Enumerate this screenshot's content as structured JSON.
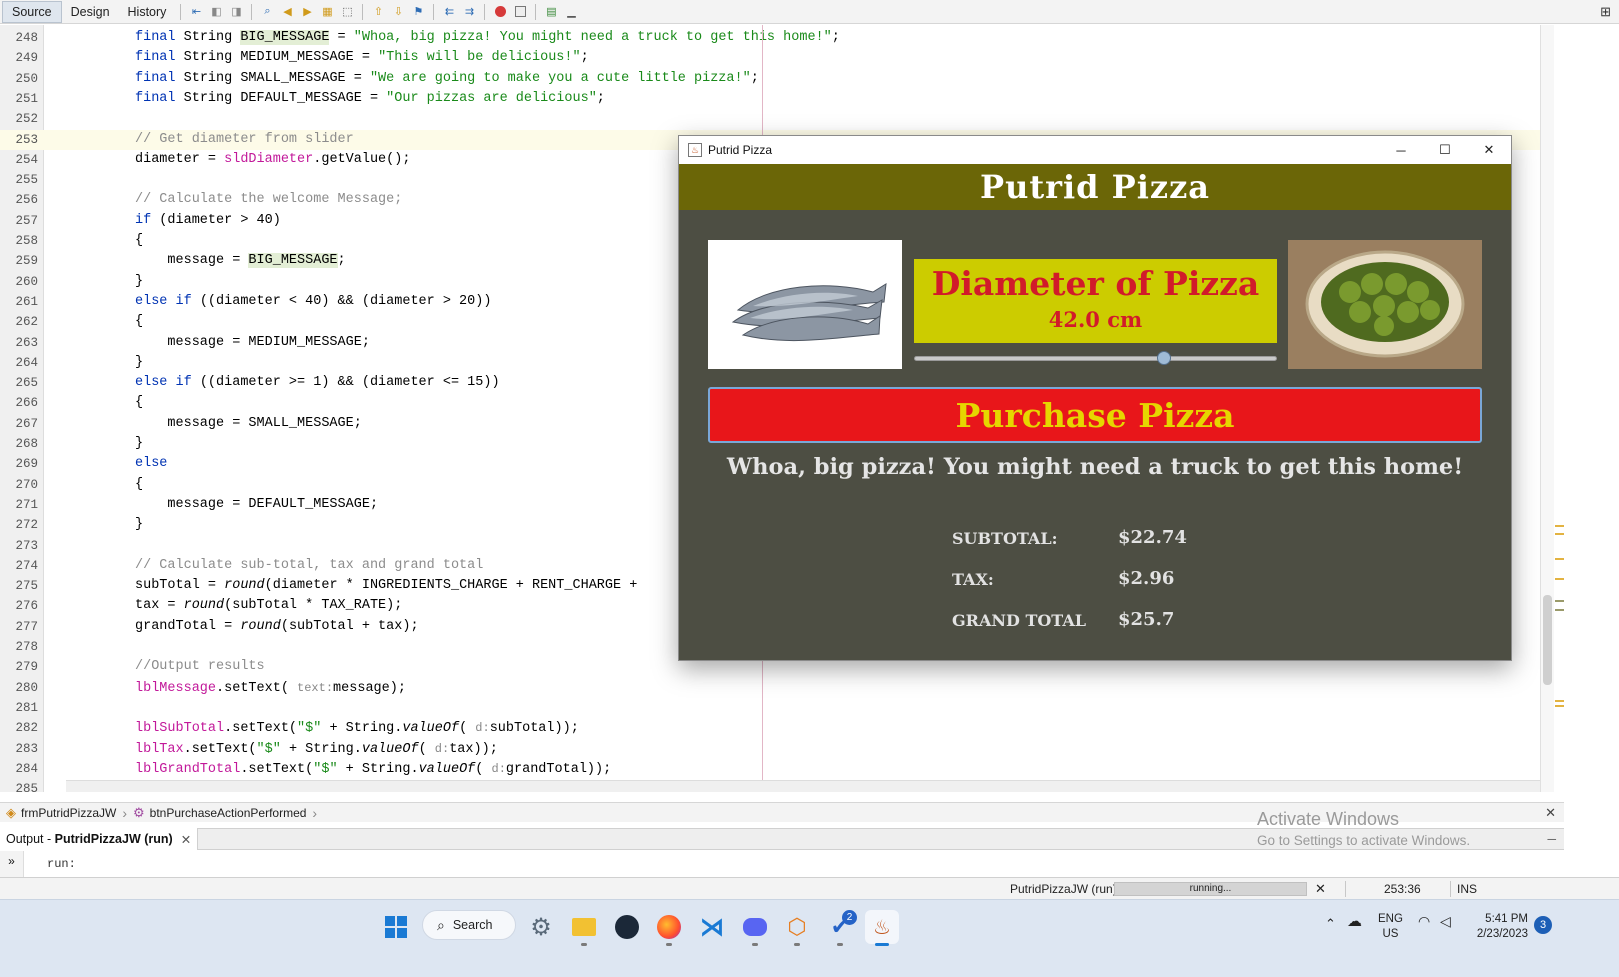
{
  "ide": {
    "tabs": [
      "Source",
      "Design",
      "History"
    ],
    "code_lines": [
      {
        "n": "248",
        "html": "<span class=\"kw\">final</span> String <span class=\"hl\">BIG_MESSAGE</span> = <span class=\"str\">\"Whoa, big pizza! You might need a truck to get this home!\"</span>;"
      },
      {
        "n": "249",
        "html": "<span class=\"kw\">final</span> String MEDIUM_MESSAGE = <span class=\"str\">\"This will be delicious!\"</span>;"
      },
      {
        "n": "250",
        "html": "<span class=\"kw\">final</span> String SMALL_MESSAGE = <span class=\"str\">\"We are going to make you a cute little pizza!\"</span>;"
      },
      {
        "n": "251",
        "html": "<span class=\"kw\">final</span> String DEFAULT_MESSAGE = <span class=\"str\">\"Our pizzas are delicious\"</span>;"
      },
      {
        "n": "252",
        "html": ""
      },
      {
        "n": "253",
        "html": "<span class=\"cmt\">// Get diameter from slider</span>",
        "current": true
      },
      {
        "n": "254",
        "html": "diameter = <span class=\"fld\">sldDiameter</span>.getValue();"
      },
      {
        "n": "255",
        "html": ""
      },
      {
        "n": "256",
        "html": "<span class=\"cmt\">// Calculate the welcome Message;</span>"
      },
      {
        "n": "257",
        "html": "<span class=\"kw\">if</span> (diameter &gt; 40)"
      },
      {
        "n": "258",
        "html": "{"
      },
      {
        "n": "259",
        "html": "    message = <span class=\"hl\">BIG_MESSAGE</span>;"
      },
      {
        "n": "260",
        "html": "}"
      },
      {
        "n": "261",
        "html": "<span class=\"kw\">else if</span> ((diameter &lt; 40) &amp;&amp; (diameter &gt; 20))"
      },
      {
        "n": "262",
        "html": "{"
      },
      {
        "n": "263",
        "html": "    message = MEDIUM_MESSAGE;"
      },
      {
        "n": "264",
        "html": "}"
      },
      {
        "n": "265",
        "html": "<span class=\"kw\">else if</span> ((diameter &gt;= 1) &amp;&amp; (diameter &lt;= 15))"
      },
      {
        "n": "266",
        "html": "{"
      },
      {
        "n": "267",
        "html": "    message = SMALL_MESSAGE;"
      },
      {
        "n": "268",
        "html": "}"
      },
      {
        "n": "269",
        "html": "<span class=\"kw\">else</span>"
      },
      {
        "n": "270",
        "html": "{"
      },
      {
        "n": "271",
        "html": "    message = DEFAULT_MESSAGE;"
      },
      {
        "n": "272",
        "html": "}"
      },
      {
        "n": "273",
        "html": ""
      },
      {
        "n": "274",
        "html": "<span class=\"cmt\">// Calculate sub-total, tax and grand total</span>"
      },
      {
        "n": "275",
        "html": "subTotal = <span class=\"ital\">round</span>(diameter * INGREDIENTS_CHARGE + RENT_CHARGE +"
      },
      {
        "n": "276",
        "html": "tax = <span class=\"ital\">round</span>(subTotal * TAX_RATE);"
      },
      {
        "n": "277",
        "html": "grandTotal = <span class=\"ital\">round</span>(subTotal + tax);"
      },
      {
        "n": "278",
        "html": ""
      },
      {
        "n": "279",
        "html": "<span class=\"cmt\">//Output results</span>"
      },
      {
        "n": "280",
        "html": "<span class=\"fld\">lblMessage</span>.setText( <span class=\"hint\">text:</span>message);"
      },
      {
        "n": "281",
        "html": ""
      },
      {
        "n": "282",
        "html": "<span class=\"fld\">lblSubTotal</span>.setText(<span class=\"str\">\"$\"</span> + String.<span class=\"ital\">valueOf</span>( <span class=\"hint\">d:</span>subTotal));"
      },
      {
        "n": "283",
        "html": "<span class=\"fld\">lblTax</span>.setText(<span class=\"str\">\"$\"</span> + String.<span class=\"ital\">valueOf</span>( <span class=\"hint\">d:</span>tax));"
      },
      {
        "n": "284",
        "html": "<span class=\"fld\">lblGrandTotal</span>.setText(<span class=\"str\">\"$\"</span> + String.<span class=\"ital\">valueOf</span>( <span class=\"hint\">d:</span>grandTotal));"
      },
      {
        "n": "285",
        "html": "    }",
        "cut": true
      }
    ],
    "breadcrumb": {
      "form": "frmPutridPizzaJW",
      "method": "btnPurchaseActionPerformed"
    },
    "output": {
      "tab_prefix": "Output - ",
      "tab_project": "PutridPizzaJW (run)",
      "run_text": "run:"
    },
    "watermark": {
      "line1": "Activate Windows",
      "line2": "Go to Settings to activate Windows."
    },
    "status": {
      "project": "PutridPizzaJW (run)",
      "progress_text": "running...",
      "position": "253:36",
      "mode": "INS"
    }
  },
  "app": {
    "window_title": "Putrid Pizza",
    "header": "Putrid Pizza",
    "diameter_label": "Diameter of Pizza",
    "diameter_value": "42.0 cm",
    "slider": {
      "value_fraction": 0.69
    },
    "purchase_label": "Purchase Pizza",
    "message": "Whoa, big pizza! You might need a truck to get this home!",
    "totals": {
      "subtotal_label": "SUBTOTAL:",
      "subtotal_value": "$22.74",
      "tax_label": "TAX:",
      "tax_value": "$2.96",
      "grand_label": "GRAND TOTAL",
      "grand_value": "$25.7"
    }
  },
  "taskbar": {
    "search_label": "Search",
    "lang": "ENG",
    "region": "US",
    "time": "5:41 PM",
    "date": "2/23/2023",
    "badge": "2",
    "notifications": "3"
  }
}
